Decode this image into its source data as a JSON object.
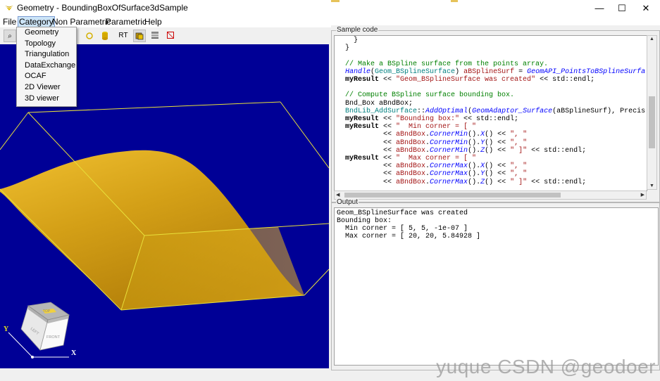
{
  "window": {
    "title": "Geometry - BoundingBoxOfSurface3dSample",
    "controls": {
      "minimize": "—",
      "maximize": "☐",
      "close": "✕"
    }
  },
  "menubar": [
    "File",
    "Category",
    "Non Parametric",
    "Parametric",
    "Help"
  ],
  "category_menu": [
    "Geometry",
    "Topology",
    "Triangulation",
    "DataExchange",
    "OCAF",
    "2D Viewer",
    "3D viewer"
  ],
  "toolbar": {
    "zoom_icon": "⌕",
    "rt_label": "RT"
  },
  "viewport": {
    "background_color": "#000096",
    "surface_color": "#d4a017",
    "box_color": "#e8e03a",
    "view_cube": {
      "top": "TOP",
      "left": "LEFT",
      "front": "FRONT"
    },
    "axes": {
      "x": "X",
      "y": "Y"
    }
  },
  "sample_code": {
    "label": "Sample code",
    "lines": [
      "  }",
      "}",
      "",
      "// Make a BSpline surface from the points array.",
      "Handle(Geom_BSplineSurface) aBSplineSurf = GeomAPI_PointsToBSplineSurfa",
      "myResult << \"Geom_BSplineSurface was created\" << std::endl;",
      "",
      "// Compute BSpline surface bounding box.",
      "Bnd_Box aBndBox;",
      "BndLib_AddSurface::AddOptimal(GeomAdaptor_Surface(aBSplineSurf), Precis",
      "myResult << \"Bounding box:\" << std::endl;",
      "myResult << \"  Min corner = [ \"",
      "         << aBndBox.CornerMin().X() << \", \"",
      "         << aBndBox.CornerMin().Y() << \", \"",
      "         << aBndBox.CornerMin().Z() << \" ]\" << std::endl;",
      "myResult << \"  Max corner = [ \"",
      "         << aBndBox.CornerMax().X() << \", \"",
      "         << aBndBox.CornerMax().Y() << \", \"",
      "         << aBndBox.CornerMax().Z() << \" ]\" << std::endl;"
    ]
  },
  "output": {
    "label": "Output",
    "lines": [
      "Geom_BSplineSurface was created",
      "Bounding box:",
      "  Min corner = [ 5, 5, -1e-07 ]",
      "  Max corner = [ 20, 20, 5.84928 ]"
    ]
  },
  "watermark": "yuque CSDN @geodoer"
}
